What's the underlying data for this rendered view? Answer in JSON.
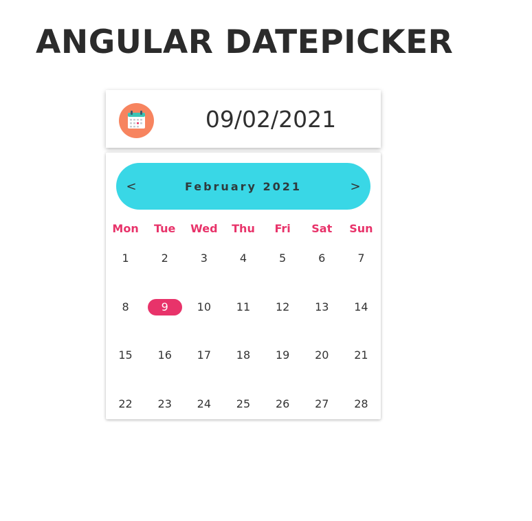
{
  "page": {
    "title": "ANGULAR DATEPICKER"
  },
  "datepicker": {
    "value": "09/02/2021",
    "icon": "calendar-icon",
    "month_label": "February 2021",
    "prev_label": "<",
    "next_label": ">",
    "weekdays": [
      "Mon",
      "Tue",
      "Wed",
      "Thu",
      "Fri",
      "Sat",
      "Sun"
    ],
    "days": [
      "1",
      "2",
      "3",
      "4",
      "5",
      "6",
      "7",
      "8",
      "9",
      "10",
      "11",
      "12",
      "13",
      "14",
      "15",
      "16",
      "17",
      "18",
      "19",
      "20",
      "21",
      "22",
      "23",
      "24",
      "25",
      "26",
      "27",
      "28"
    ],
    "selected_day": "9",
    "colors": {
      "accent": "#e8336a",
      "month_bar": "#39d7e6",
      "icon_bg": "#f7845f"
    }
  }
}
